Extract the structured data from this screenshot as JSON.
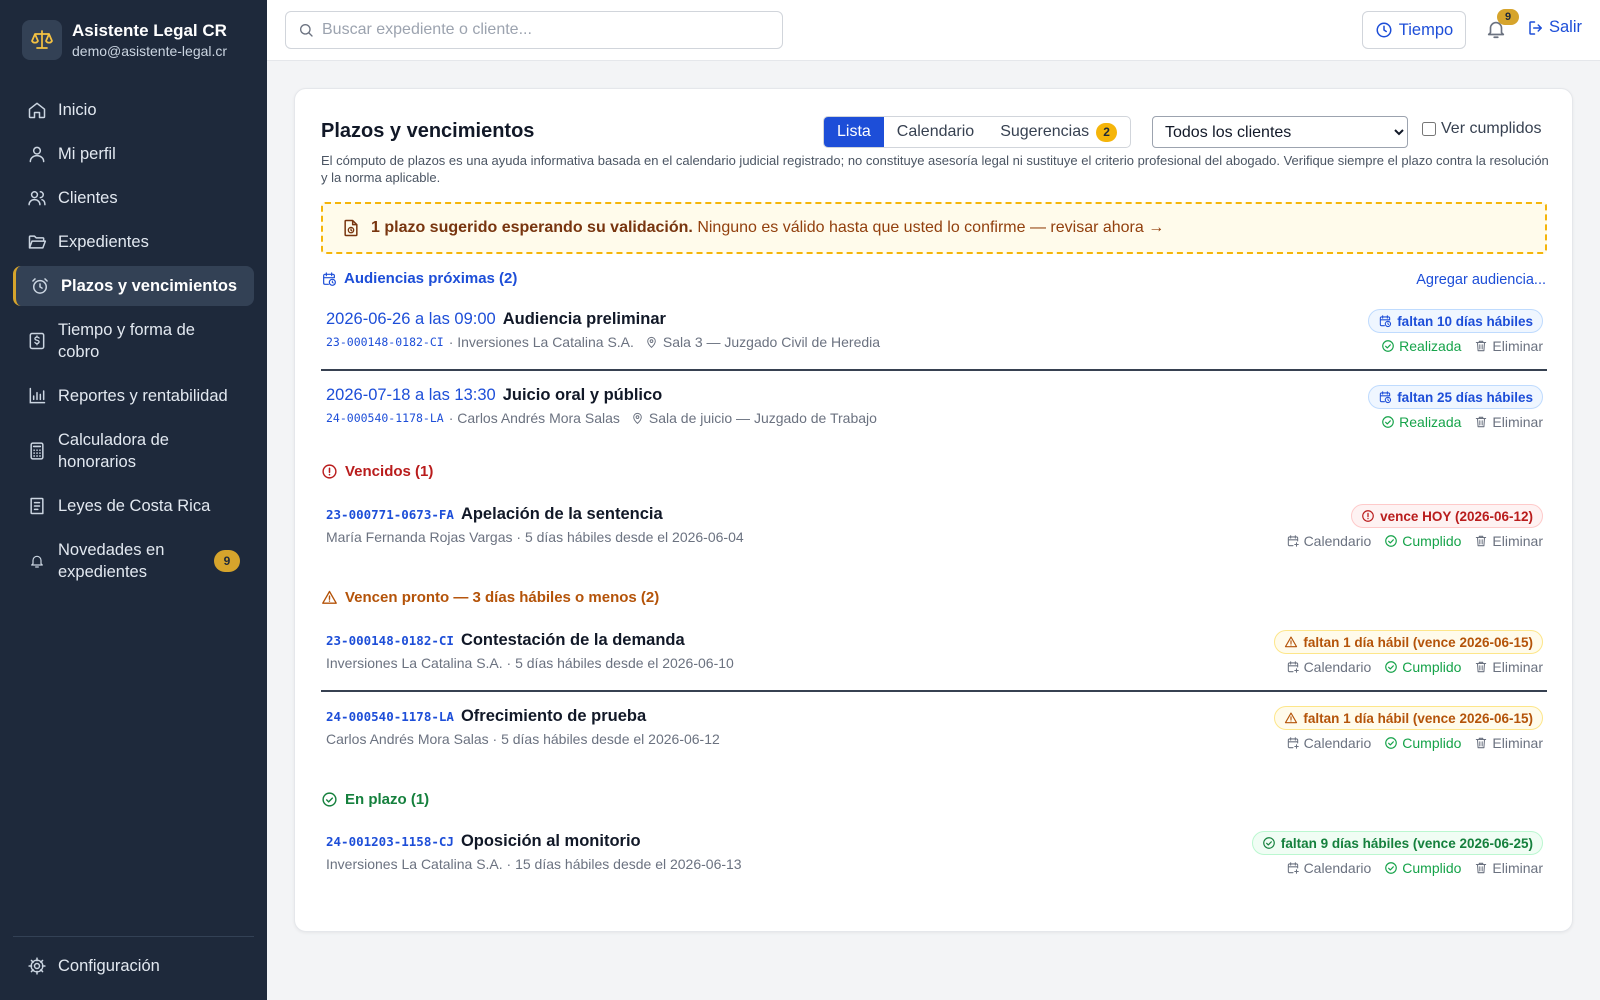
{
  "brand": {
    "name": "Asistente Legal CR",
    "email": "demo@asistente-legal.cr"
  },
  "nav": {
    "items": [
      {
        "label": "Inicio"
      },
      {
        "label": "Mi perfil"
      },
      {
        "label": "Clientes"
      },
      {
        "label": "Expedientes"
      },
      {
        "label": "Plazos y vencimientos"
      },
      {
        "label": "Tiempo y forma de cobro"
      },
      {
        "label": "Reportes y rentabilidad"
      },
      {
        "label": "Calculadora de honorarios"
      },
      {
        "label": "Leyes de Costa Rica"
      },
      {
        "label": "Novedades en expedientes",
        "badge": "9"
      }
    ],
    "config_label": "Configuración"
  },
  "topbar": {
    "search_placeholder": "Buscar expediente o cliente...",
    "tiempo_label": "Tiempo",
    "bell_count": "9",
    "salir_label": "Salir"
  },
  "main": {
    "title": "Plazos y vencimientos",
    "tabs": {
      "lista": "Lista",
      "calendario": "Calendario",
      "sugerencias": "Sugerencias",
      "sugerencias_count": "2"
    },
    "client_filter": "Todos los clientes",
    "ver_cumplidos": "Ver cumplidos",
    "disclaimer": "El cómputo de plazos es una ayuda informativa basada en el calendario judicial registrado; no constituye asesoría legal ni sustituye el criterio profesional del abogado. Verifique siempre el plazo contra la resolución y la norma aplicable.",
    "alert_bold": "1 plazo sugerido esperando su validación.",
    "alert_text": "Ninguno es válido hasta que usted lo confirme — revisar ahora →",
    "actions": {
      "realizada": "Realizada",
      "eliminar": "Eliminar",
      "calendario": "Calendario",
      "cumplido": "Cumplido"
    }
  },
  "audiencias": {
    "heading": "Audiencias próximas (2)",
    "add_label": "Agregar audiencia...",
    "items": [
      {
        "date": "2026-06-26 a las 09:00",
        "title": "Audiencia preliminar",
        "code": "23-000148-0182-CI",
        "client": "· Inversiones La Catalina S.A.",
        "location": "Sala 3 — Juzgado Civil de Heredia",
        "pill": "faltan 10 días hábiles"
      },
      {
        "date": "2026-07-18 a las 13:30",
        "title": "Juicio oral y público",
        "code": "24-000540-1178-LA",
        "client": "· Carlos Andrés Mora Salas",
        "location": "Sala de juicio — Juzgado de Trabajo",
        "pill": "faltan 25 días hábiles"
      }
    ]
  },
  "vencidos": {
    "heading": "Vencidos (1)",
    "items": [
      {
        "code": "23-000771-0673-FA",
        "title": "Apelación de la sentencia",
        "detail": "María Fernanda Rojas Vargas · 5 días hábiles desde el 2026-06-04",
        "pill": "vence HOY (2026-06-12)"
      }
    ]
  },
  "pronto": {
    "heading": "Vencen pronto — 3 días hábiles o menos (2)",
    "items": [
      {
        "code": "23-000148-0182-CI",
        "title": "Contestación de la demanda",
        "detail": "Inversiones La Catalina S.A. · 5 días hábiles desde el 2026-06-10",
        "pill": "faltan 1 día hábil (vence 2026-06-15)"
      },
      {
        "code": "24-000540-1178-LA",
        "title": "Ofrecimiento de prueba",
        "detail": "Carlos Andrés Mora Salas · 5 días hábiles desde el 2026-06-12",
        "pill": "faltan 1 día hábil (vence 2026-06-15)"
      }
    ]
  },
  "en_plazo": {
    "heading": "En plazo (1)",
    "items": [
      {
        "code": "24-001203-1158-CJ",
        "title": "Oposición al monitorio",
        "detail": "Inversiones La Catalina S.A. · 15 días hábiles desde el 2026-06-13",
        "pill": "faltan 9 días hábiles (vence 2026-06-25)"
      }
    ]
  },
  "colors": {
    "sidebar": "#1e293b",
    "accent": "#1d4ed8",
    "gold": "#d6a42c",
    "danger": "#b91c1c",
    "warning": "#b45309",
    "success": "#15803d"
  }
}
